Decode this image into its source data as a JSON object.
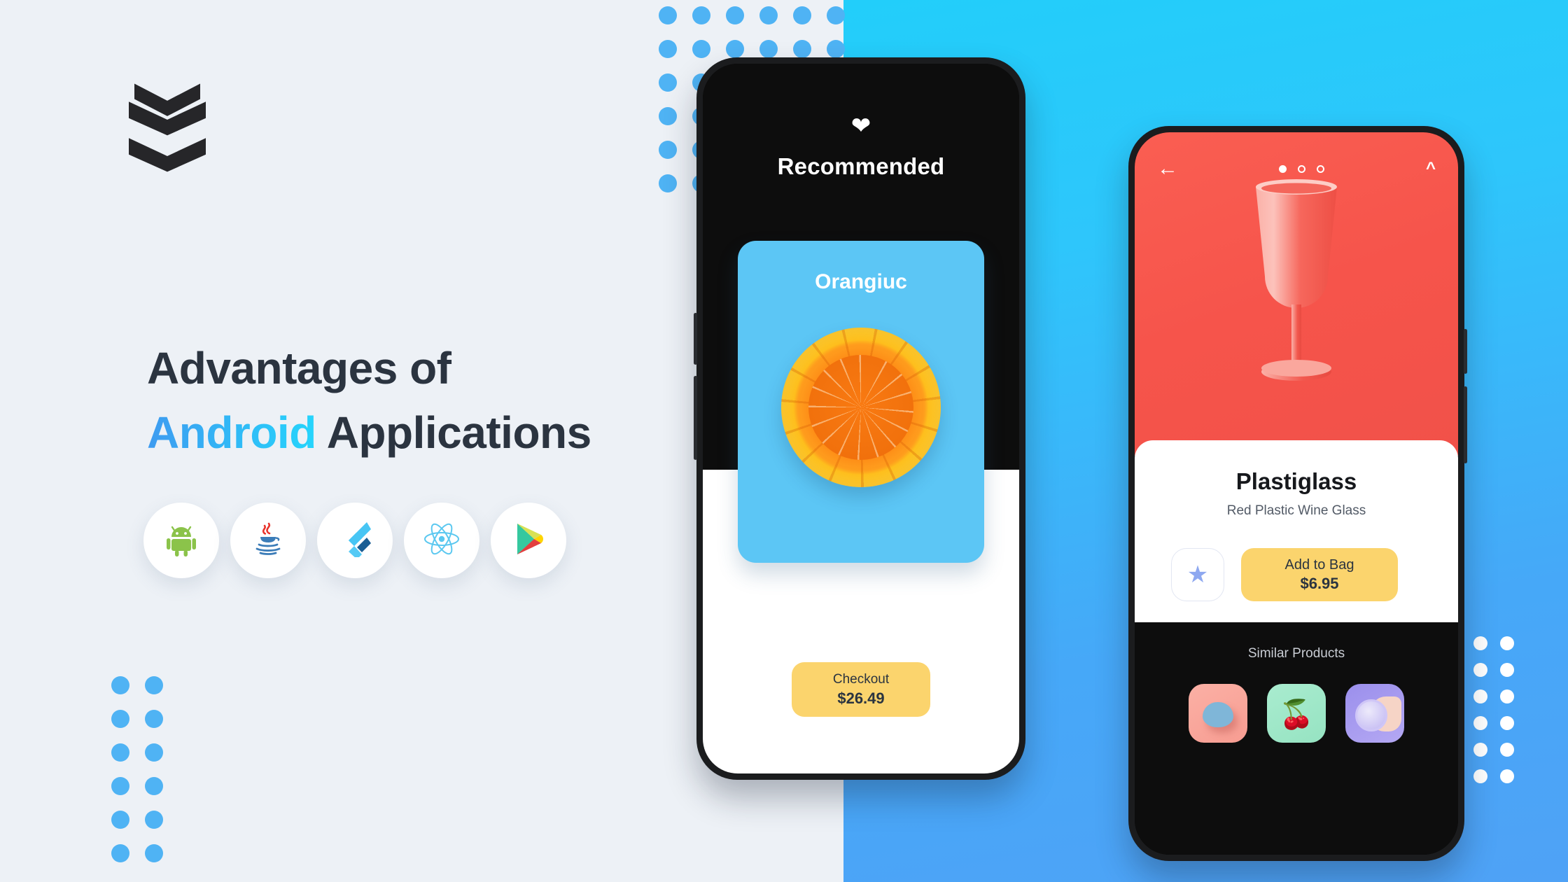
{
  "brand": {
    "logo_name": "chevron-stack-logo"
  },
  "headline": {
    "line1": "Advantages of",
    "accent_word": "Android",
    "line2_rest": " Applications",
    "text_color": "#2B3440",
    "accent_gradient_from": "#3E9BF0",
    "accent_gradient_to": "#25D5FC"
  },
  "tech_icons": [
    {
      "name": "android-icon",
      "label": "Android"
    },
    {
      "name": "java-icon",
      "label": "Java"
    },
    {
      "name": "flutter-icon",
      "label": "Flutter"
    },
    {
      "name": "react-icon",
      "label": "React"
    },
    {
      "name": "google-play-icon",
      "label": "Google Play"
    }
  ],
  "background": {
    "left_color": "#EDF1F6",
    "right_gradient_from": "#22CEFA",
    "right_gradient_to": "#4FA2F6",
    "dot_blue": "#4FB3F4",
    "dot_white": "#FFFFFF"
  },
  "phone_left": {
    "heart_icon": "heart-icon",
    "title": "Recommended",
    "card": {
      "title": "Orangiuc",
      "background": "#5CC6F5",
      "image": "orange-slice-image"
    },
    "checkout": {
      "label": "Checkout",
      "price": "$26.49",
      "color": "#FBD46D"
    }
  },
  "phone_right": {
    "back_icon": "back-arrow-icon",
    "expand_icon": "chevron-up-icon",
    "carousel": {
      "total": 3,
      "active": 1
    },
    "hero": {
      "image": "wine-glass-image",
      "background": "#F6544B"
    },
    "product": {
      "name": "Plastiglass",
      "subtitle": "Red Plastic Wine Glass",
      "favorite_icon": "star-icon",
      "favorite_color": "#8EA8F0",
      "add_label": "Add to Bag",
      "add_price": "$6.95",
      "add_color": "#FBD46D"
    },
    "similar": {
      "title": "Similar Products",
      "items": [
        {
          "name": "similar-product-1",
          "background": "#FBB0A5"
        },
        {
          "name": "similar-product-2",
          "background": "#A9ECCF"
        },
        {
          "name": "similar-product-3",
          "background": "#9B8FEC"
        }
      ]
    }
  }
}
